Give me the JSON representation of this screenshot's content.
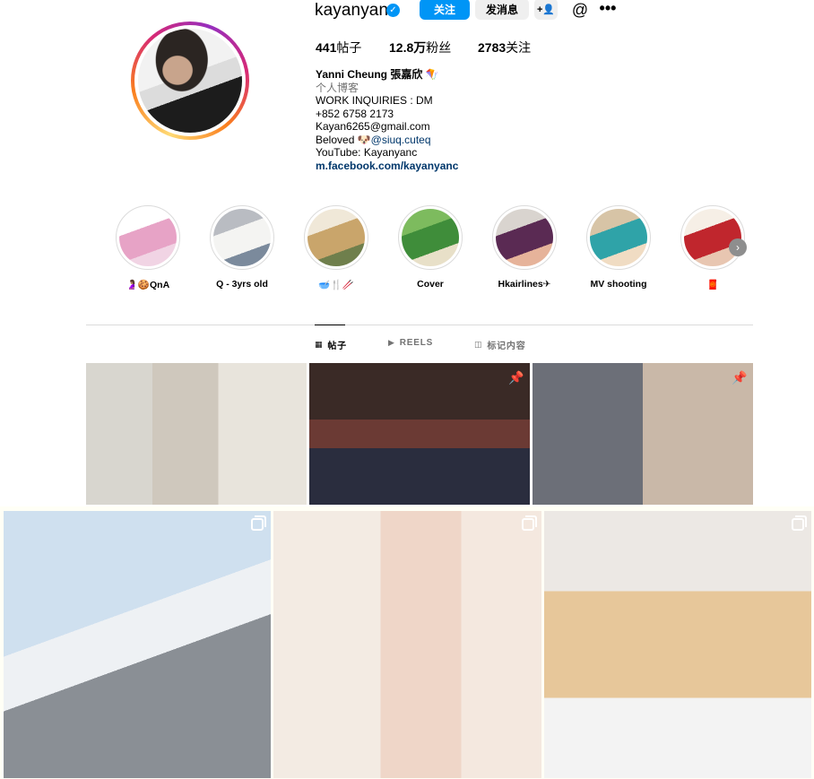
{
  "profile": {
    "username": "kayanyanc",
    "verified_mark": "✓",
    "follow_label": "关注",
    "message_label": "发消息",
    "suggest_label": "+👤",
    "threads_icon": "@",
    "more_icon": "•••",
    "stats": {
      "posts": "441",
      "posts_label": "帖子",
      "followers": "12.8万",
      "followers_label": "粉丝",
      "following": "2783",
      "following_label": "关注"
    },
    "bio": {
      "name": "Yanni Cheung 張嘉欣 🪁",
      "category": "个人博客",
      "lines": [
        "WORK INQUIRIES : DM",
        "+852 6758 2173",
        "Kayan6265@gmail.com"
      ],
      "beloved_prefix": "Beloved 🐶",
      "beloved_mention": "@siuq.cuteq",
      "youtube": "YouTube: Kayanyanc",
      "link": "m.facebook.com/kayanyanc"
    }
  },
  "highlights": [
    {
      "label": "🤰🏽🍪QnA",
      "colors": [
        "#ffffff",
        "#e7a3c6",
        "#f1d4e4"
      ]
    },
    {
      "label": "Q - 3yrs old",
      "colors": [
        "#b9bcc2",
        "#f4f4f2",
        "#7b8a9c"
      ]
    },
    {
      "label": "🥣🍴🥢",
      "colors": [
        "#f0e8d8",
        "#c9a56b",
        "#6f7f4c"
      ]
    },
    {
      "label": "Cover",
      "colors": [
        "#7dbb5e",
        "#3f8d3a",
        "#e8e0c8"
      ]
    },
    {
      "label": "Hkairlines✈",
      "colors": [
        "#d9d4cf",
        "#5a2a53",
        "#e6b39a"
      ]
    },
    {
      "label": "MV shooting",
      "colors": [
        "#d7c4a6",
        "#2fa3a8",
        "#f0dcc3"
      ]
    },
    {
      "label": "🧧",
      "colors": [
        "#f6efe6",
        "#c0262d",
        "#e8c6b1"
      ]
    }
  ],
  "next_icon": "›",
  "tabs": [
    {
      "icon": "▦",
      "label": "帖子",
      "active": true
    },
    {
      "icon": "▶",
      "label": "REELS",
      "active": false
    },
    {
      "icon": "◫",
      "label": "标记内容",
      "active": false
    }
  ],
  "posts": [
    {
      "badge": "none",
      "bg": "linear-gradient(90deg,#d8d6cf 0 30%,#cfc8bd 30% 60%,#e8e4dc 60%)"
    },
    {
      "badge": "pin",
      "bg": "linear-gradient(180deg,#3a2a26 0 40%,#6b3a34 40% 60%,#2a2d3e 60%)"
    },
    {
      "badge": "pin",
      "bg": "linear-gradient(90deg,#6c6f78 0 50%,#c9b8a8 50% 100%)"
    },
    {
      "badge": "multi",
      "bg": "linear-gradient(160deg,#cfe0ef 0 40%,#eef1f4 40% 55%,#8a8f95 55%)"
    },
    {
      "badge": "multi",
      "bg": "linear-gradient(90deg,#f3ebe3 0 40%,#efd6c8 40% 70%,#f4e8df 70%)"
    },
    {
      "badge": "multi",
      "bg": "linear-gradient(180deg,#ece8e4 0 30%,#e7c79a 30% 70%,#f3f3f3 70%)"
    }
  ],
  "icons": {
    "pin": "📌"
  }
}
